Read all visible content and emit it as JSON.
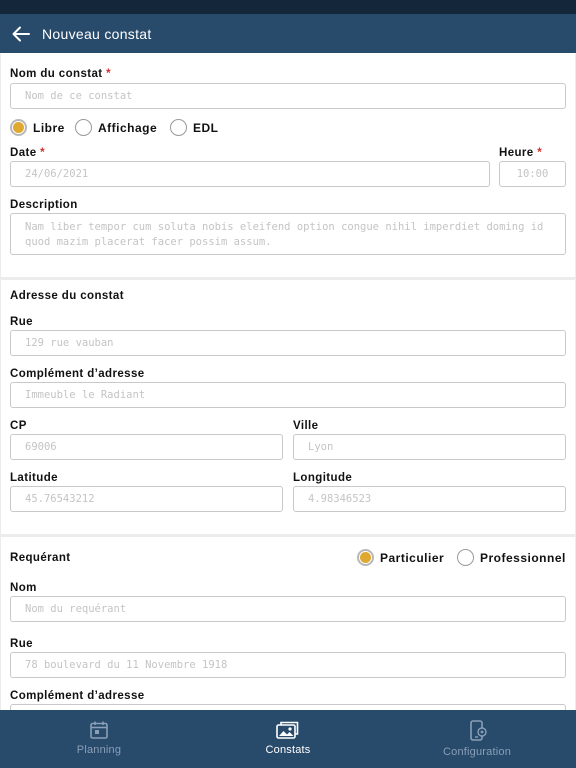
{
  "header": {
    "title": "Nouveau constat",
    "back_icon": "arrow-left-icon"
  },
  "constat": {
    "name_label": "Nom du constat",
    "name_placeholder": "Nom de ce constat",
    "required_mark": "*",
    "types": [
      {
        "label": "Libre",
        "selected": true
      },
      {
        "label": "Affichage",
        "selected": false
      },
      {
        "label": "EDL",
        "selected": false
      }
    ],
    "date_label": "Date",
    "date_value": "24/06/2021",
    "time_label": "Heure",
    "time_value": "10:00",
    "description_label": "Description",
    "description_value": "Nam liber tempor cum soluta nobis eleifend option congue nihil imperdiet doming id quod mazim placerat facer possim assum."
  },
  "adresse": {
    "section_title": "Adresse du constat",
    "rue_label": "Rue",
    "rue_value": "129 rue vauban",
    "complement_label": "Complément d’adresse",
    "complement_value": "Immeuble le Radiant",
    "cp_label": "CP",
    "cp_value": "69006",
    "ville_label": "Ville",
    "ville_value": "Lyon",
    "latitude_label": "Latitude",
    "latitude_value": "45.76543212",
    "longitude_label": "Longitude",
    "longitude_value": "4.98346523"
  },
  "requerant": {
    "section_title": "Requérant",
    "types": [
      {
        "label": "Particulier",
        "selected": true
      },
      {
        "label": "Professionnel",
        "selected": false
      }
    ],
    "nom_label": "Nom",
    "nom_placeholder": "Nom du requérant",
    "rue_label": "Rue",
    "rue_value": "78 boulevard du 11 Novembre 1918",
    "complement_label": "Complément d’adresse"
  },
  "nav": {
    "items": [
      {
        "label": "Planning",
        "icon": "calendar-icon",
        "active": false
      },
      {
        "label": "Constats",
        "icon": "images-icon",
        "active": true
      },
      {
        "label": "Configuration",
        "icon": "phone-settings-icon",
        "active": false
      }
    ]
  },
  "colors": {
    "appbar": "#284a6b",
    "statusbar": "#14263a",
    "accent": "#e0a82e",
    "required": "#d0312d"
  }
}
